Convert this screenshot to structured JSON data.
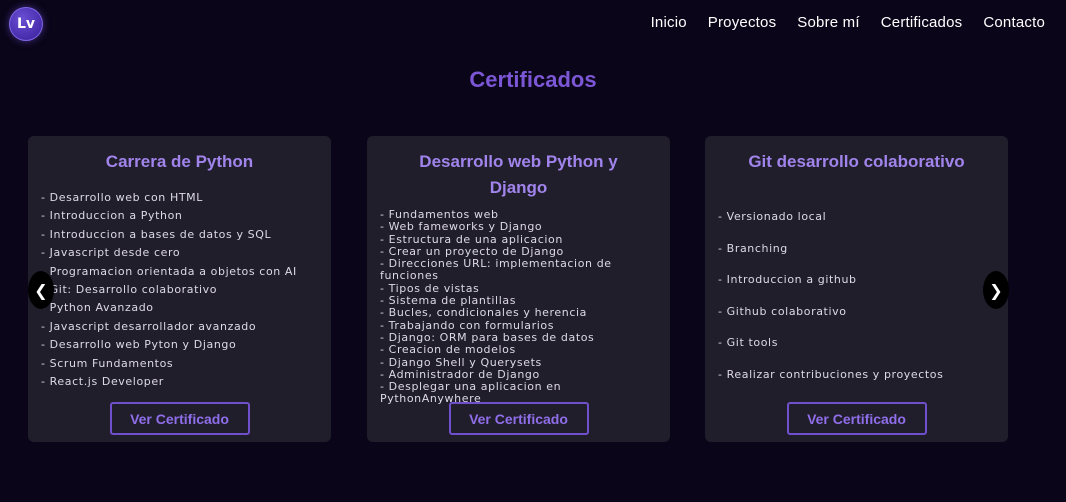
{
  "logo": {
    "text": "Lv"
  },
  "nav": [
    "Inicio",
    "Proyectos",
    "Sobre mí",
    "Certificados",
    "Contacto"
  ],
  "section_title": "Certificados",
  "carousel": {
    "prev_glyph": "❮",
    "next_glyph": "❯"
  },
  "cards": [
    {
      "title": "Carrera de Python",
      "items": [
        "Desarrollo web con HTML",
        "Introduccion a Python",
        "Introduccion a bases de datos y SQL",
        "Javascript desde cero",
        "Programacion orientada a objetos con AI",
        "Git: Desarrollo colaborativo",
        "Python Avanzado",
        "Javascript desarrollador avanzado",
        "Desarrollo web Pyton y Django",
        "Scrum Fundamentos",
        "React.js Developer"
      ],
      "button": "Ver Certificado"
    },
    {
      "title": "Desarrollo web Python y Django",
      "items": [
        "Fundamentos web",
        "Web fameworks y Django",
        "Estructura de una aplicacion",
        "Crear un proyecto de Django",
        "Direcciones URL: implementacion de funciones",
        "Tipos de vistas",
        "Sistema de plantillas",
        "Bucles, condicionales y herencia",
        "Trabajando con formularios",
        "Django: ORM para bases de datos",
        "Creacion de modelos",
        "Django Shell y Querysets",
        "Administrador de Django",
        "Desplegar una aplicacion en PythonAnywhere"
      ],
      "button": "Ver Certificado"
    },
    {
      "title": "Git desarrollo colaborativo",
      "items": [
        "Versionado local",
        "Branching",
        "Introduccion a github",
        "Github colaborativo",
        "Git tools",
        "Realizar contribuciones y proyectos"
      ],
      "button": "Ver Certificado"
    }
  ]
}
